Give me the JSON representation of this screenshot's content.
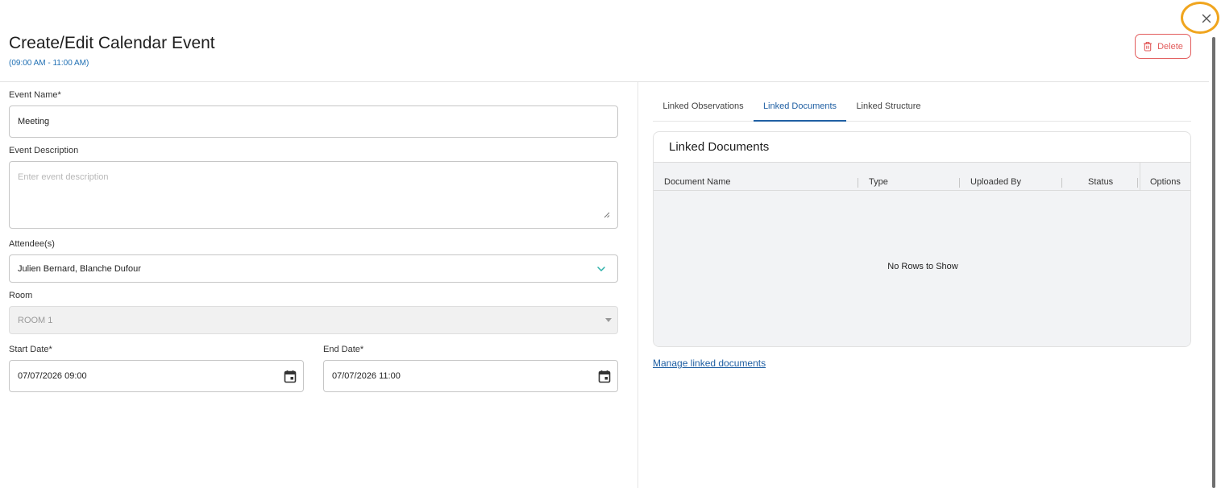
{
  "dialog": {
    "title": "Create/Edit Calendar Event",
    "time_range": "(09:00 AM - 11:00 AM)",
    "delete_label": "Delete",
    "close_glyph": "×"
  },
  "form": {
    "event_name": {
      "label": "Event Name*",
      "value": "Meeting"
    },
    "event_description": {
      "label": "Event Description",
      "placeholder": "Enter event description"
    },
    "attendees": {
      "label": "Attendee(s)",
      "value": "Julien Bernard, Blanche Dufour"
    },
    "room": {
      "label": "Room",
      "value": "ROOM 1"
    },
    "start_date": {
      "label": "Start Date*",
      "value": "07/07/2026 09:00"
    },
    "end_date": {
      "label": "End Date*",
      "value": "07/07/2026 11:00"
    }
  },
  "tabs": [
    {
      "label": "Linked Observations",
      "active": false
    },
    {
      "label": "Linked Documents",
      "active": true
    },
    {
      "label": "Linked Structure",
      "active": false
    }
  ],
  "linked_documents": {
    "title": "Linked Documents",
    "columns": [
      "Document Name",
      "Type",
      "Uploaded By",
      "Status",
      "Options"
    ],
    "empty_message": "No Rows to Show",
    "manage_link": "Manage linked documents"
  },
  "icons": {
    "close": "close-icon",
    "delete": "trash-icon",
    "attendees_dropdown": "chevron-down-icon",
    "room_dropdown": "caret-down-icon",
    "date_picker": "calendar-icon",
    "resize": "resize-handle-icon"
  },
  "colors": {
    "accent": "#1f5fa3",
    "danger": "#e25b5b",
    "chevron": "#2bb0a8",
    "focus_ring": "#f0a51e"
  }
}
